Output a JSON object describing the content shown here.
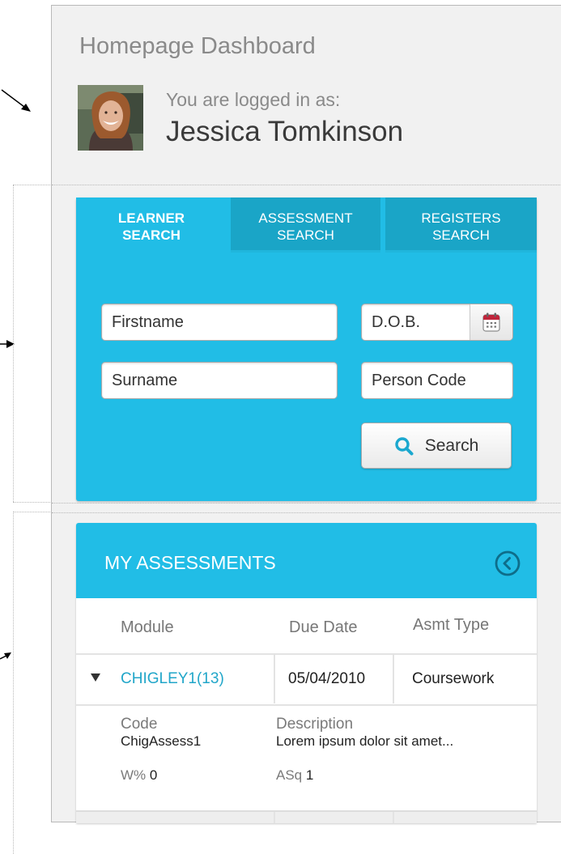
{
  "header": {
    "title": "Homepage Dashboard",
    "logged_in_label": "You are logged in as:",
    "user_name": "Jessica Tomkinson"
  },
  "search": {
    "tabs": [
      {
        "line1": "LEARNER",
        "line2": "SEARCH",
        "active": true
      },
      {
        "line1": "ASSESSMENT",
        "line2": "SEARCH",
        "active": false
      },
      {
        "line1": "REGISTERS",
        "line2": "SEARCH",
        "active": false
      }
    ],
    "fields": {
      "firstname": "Firstname",
      "dob": "D.O.B.",
      "surname": "Surname",
      "person_code": "Person Code"
    },
    "button_label": "Search"
  },
  "assessments": {
    "title": "MY ASSESSMENTS",
    "columns": [
      "Module",
      "Due Date",
      "Asmt Type"
    ],
    "row": {
      "module": "CHIGLEY1(13)",
      "due_date": "05/04/2010",
      "type": "Coursework"
    },
    "detail": {
      "code_label": "Code",
      "code_value": "ChigAssess1",
      "description_label": "Description",
      "description_value": "Lorem ipsum dolor sit amet...",
      "weight_label": "W%",
      "weight_value": "0",
      "sequence_label": "ASq",
      "sequence_value": "1"
    }
  },
  "colors": {
    "accent": "#21bde6",
    "tab_inactive": "#1aa5c7",
    "link": "#21a6c9",
    "panel_bg": "#f1f1f1"
  },
  "icons": [
    "calendar-icon",
    "search-icon",
    "collapse-circle-icon",
    "triangle-down-icon",
    "annotation-arrow-icon"
  ]
}
